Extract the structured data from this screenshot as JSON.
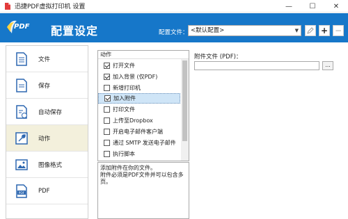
{
  "window": {
    "title": "迅捷PDF虚拟打印机 设置",
    "minimize": "—",
    "maximize": "☐",
    "close": "✕"
  },
  "header": {
    "logo_text": "PDF",
    "title": "配置设定",
    "config_label": "配置文件：",
    "config_value": "<默认配置>"
  },
  "nav": {
    "items": [
      {
        "label": "文件",
        "icon": "document-icon"
      },
      {
        "label": "保存",
        "icon": "save-document-icon"
      },
      {
        "label": "自动保存",
        "icon": "autosave-icon"
      },
      {
        "label": "动作",
        "icon": "wrench-icon",
        "active": true
      },
      {
        "label": "图像格式",
        "icon": "image-icon"
      },
      {
        "label": "PDF",
        "icon": "pdf-file-icon"
      }
    ]
  },
  "actions": {
    "header": "动作",
    "items": [
      {
        "label": "打开文件",
        "checked": true
      },
      {
        "label": "加入背景 (仅PDF)",
        "checked": true
      },
      {
        "label": "新增打印机",
        "checked": false
      },
      {
        "label": "加入附件",
        "checked": true,
        "selected": true
      },
      {
        "label": "打印文件",
        "checked": false
      },
      {
        "label": "上传至Dropbox",
        "checked": false
      },
      {
        "label": "开启电子邮件客户端",
        "checked": false
      },
      {
        "label": "通过 SMTP 发送电子邮件",
        "checked": false
      },
      {
        "label": "执行脚本",
        "checked": false
      }
    ]
  },
  "description": {
    "line1": "添加附件在你的文件。",
    "line2": "附件必须是PDF文件并可以包含多页。"
  },
  "attachment": {
    "label": "附件文件 (PDF)：",
    "value": "",
    "browse_label": "..."
  }
}
